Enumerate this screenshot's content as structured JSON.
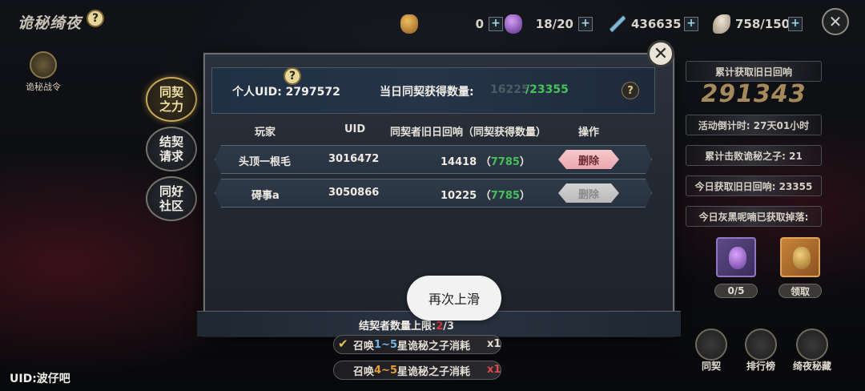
{
  "header": {
    "title": "诡秘绮夜",
    "help": "?",
    "close": "✕",
    "resources": [
      {
        "icon": "potion-pouch-icon",
        "value": "0",
        "plus": "+"
      },
      {
        "icon": "purple-potion-icon",
        "value": "18/20",
        "plus": "+"
      },
      {
        "icon": "crossed-swords-icon",
        "value": "436635",
        "plus": "+"
      },
      {
        "icon": "feather-icon",
        "value": "758/150",
        "plus": "+"
      }
    ]
  },
  "battle_pass": {
    "label": "诡秘战令"
  },
  "side_tabs": [
    {
      "label": "同契之力",
      "active": true
    },
    {
      "label": "结契请求",
      "active": false
    },
    {
      "label": "同好社区",
      "active": false
    }
  ],
  "panel": {
    "close": "✕",
    "uid_label": "个人UID: 2797572",
    "uid_help": "?",
    "count_label": "当日同契获得数量:",
    "count_current": "16225",
    "count_max": "/23355",
    "info_help": "?",
    "columns": [
      "玩家",
      "UID",
      "同契者旧日回响（同契获得数量）",
      "操作"
    ],
    "rows": [
      {
        "player": "头顶一根毛",
        "uid": "3016472",
        "echo": "14418",
        "gain": "7785",
        "action": "删除",
        "enabled": true
      },
      {
        "player": "碍事a",
        "uid": "3050866",
        "echo": "10225",
        "gain": "7785",
        "action": "删除",
        "enabled": false
      }
    ],
    "footer_prefix": "结契者数量上限:",
    "footer_red": "2",
    "footer_suffix": "/3"
  },
  "toast": "再次上滑",
  "stats": {
    "total_label": "累计获取旧日回响",
    "total_value": "291343",
    "countdown": "活动倒计时: 27天01小时",
    "defeated": "累计击败诡秘之子: 21",
    "today_echo": "今日获取旧日回响: 23355",
    "today_drop": "今日灰黑呢喃已获取掉落:",
    "reward1_label": "0/5",
    "reward2_label": "领取"
  },
  "bottom_buttons": [
    {
      "icon": "contract-icon",
      "label": "同契"
    },
    {
      "icon": "ranking-icon",
      "label": "排行榜"
    },
    {
      "icon": "treasure-icon",
      "label": "绮夜秘藏"
    }
  ],
  "quests": [
    {
      "pre": "召唤",
      "range": "1~5",
      "post": "星诡秘之子消耗",
      "count": "x1",
      "done": true
    },
    {
      "pre": "召唤",
      "range": "4~5",
      "post": "星诡秘之子消耗",
      "count": "x1",
      "done": false
    }
  ],
  "quest_check": "✔",
  "bottom_uid": "UID:波仔吧"
}
